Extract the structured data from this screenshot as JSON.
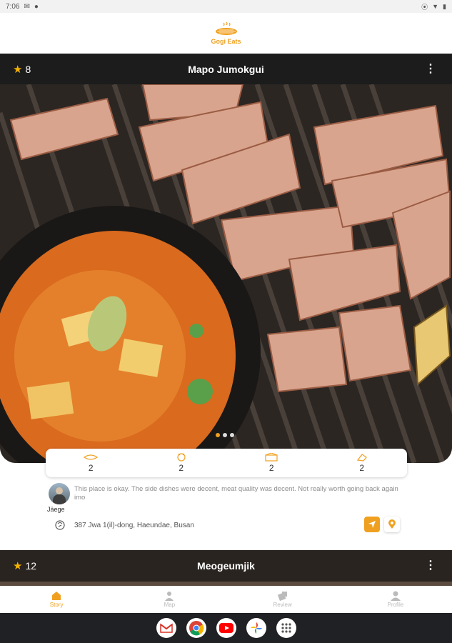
{
  "status_bar": {
    "time": "7:06",
    "icons": [
      "message-icon",
      "notification-icon",
      "location-icon",
      "wifi-icon",
      "battery-icon"
    ]
  },
  "app": {
    "logo_text": "Gogi Eats"
  },
  "colors": {
    "accent": "#f0a020",
    "header_bg": "#1c1c1c",
    "star": "#f5b301"
  },
  "card1": {
    "rating": "8",
    "title": "Mapo Jumokgui",
    "carousel_pages": 3,
    "carousel_active": 1,
    "stats": [
      {
        "icon": "meat-icon",
        "value": "2"
      },
      {
        "icon": "pig-icon",
        "value": "2"
      },
      {
        "icon": "restaurant-icon",
        "value": "2"
      },
      {
        "icon": "price-icon",
        "value": "2"
      }
    ],
    "review": {
      "reviewer": "Jäege",
      "text": "This place is okay. The side dishes were decent, meat quality was decent. Not really worth going back again imo"
    },
    "address": "387 Jwa 1(il)-dong, Haeundae, Busan"
  },
  "card2": {
    "rating": "12",
    "title": "Meogeumjik"
  },
  "bottom_nav": {
    "items": [
      {
        "label": "Story",
        "icon": "home-icon",
        "active": true
      },
      {
        "label": "Map",
        "icon": "map-user-icon",
        "active": false
      },
      {
        "label": "Review",
        "icon": "review-icon",
        "active": false
      },
      {
        "label": "Profile",
        "icon": "profile-icon",
        "active": false
      }
    ]
  },
  "dock": {
    "apps": [
      "gmail-icon",
      "chrome-icon",
      "youtube-icon",
      "photos-icon",
      "app-drawer-icon"
    ]
  }
}
